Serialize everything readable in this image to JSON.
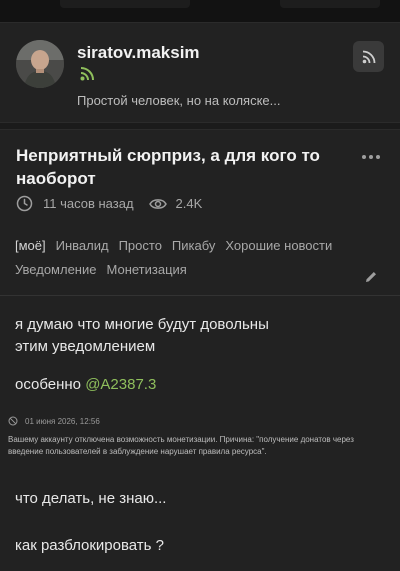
{
  "profile": {
    "username": "siratov.maksim",
    "bio": "Простой человек, но на коляске...",
    "avatar_icon": "avatar-photo",
    "rss_icon": "rss-icon",
    "subscribe_icon": "rss-feed-icon"
  },
  "post": {
    "title": "Неприятный сюрприз, а для кого то наоборот",
    "time": "11 часов назад",
    "views": "2.4K",
    "tags": [
      "[моё]",
      "Инвалид",
      "Просто",
      "Пикабу",
      "Хорошие новости",
      "Уведомление",
      "Монетизация"
    ],
    "body": {
      "p1": "я думаю что многие будут довольны этим уведомлением",
      "p2_prefix": "особенно ",
      "mention": "@A2387.3",
      "notice": {
        "date": "01 июня 2026, 12:56",
        "text": "Вашему аккаунту отключена возможность монетизации. Причина: \"получение донатов через введение пользователей в заблуждение нарушает правила ресурса\"."
      },
      "p3": "что делать, не знаю...",
      "p4": "как разблокировать ?"
    }
  },
  "colors": {
    "background": "#1b1b1b",
    "card": "#222222",
    "accent_green": "#8fbf5c",
    "muted_text": "#a8a8a8"
  }
}
